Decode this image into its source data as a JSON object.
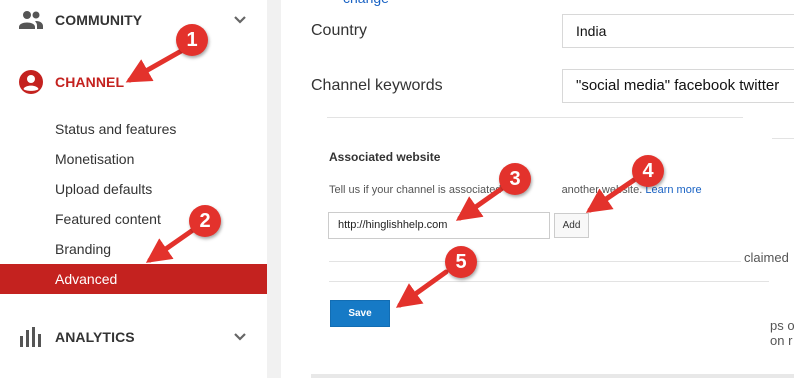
{
  "sidebar": {
    "sections": {
      "community": {
        "label": "COMMUNITY",
        "icon": "people-icon"
      },
      "channel": {
        "label": "CHANNEL",
        "icon": "account-circle-icon"
      },
      "analytics": {
        "label": "ANALYTICS",
        "icon": "bar-chart-icon"
      }
    },
    "channel_items": [
      {
        "label": "Status and features"
      },
      {
        "label": "Monetisation"
      },
      {
        "label": "Upload defaults"
      },
      {
        "label": "Featured content"
      },
      {
        "label": "Branding"
      },
      {
        "label": "Advanced",
        "active": true
      }
    ]
  },
  "main": {
    "change_link": "change",
    "country": {
      "label": "Country",
      "value": "India"
    },
    "keywords": {
      "label": "Channel keywords",
      "value": "\"social media\" facebook twitter"
    },
    "associated_website": {
      "title": "Associated website",
      "description": "Tell us if your channel is associated",
      "description_tail": "another website.",
      "learn_more": "Learn more",
      "url_value": "http://hinglishhelp.com",
      "add_label": "Add"
    },
    "save_label": "Save",
    "cutoff_fragments": [
      "claimed",
      "ps o",
      "on r"
    ]
  },
  "callouts": [
    "1",
    "2",
    "3",
    "4",
    "5"
  ],
  "colors": {
    "active_nav": "#c4221f",
    "channel_accent": "#c4221f",
    "save_button": "#167ac6",
    "link": "#1a63c4",
    "callout": "#e3322c"
  }
}
